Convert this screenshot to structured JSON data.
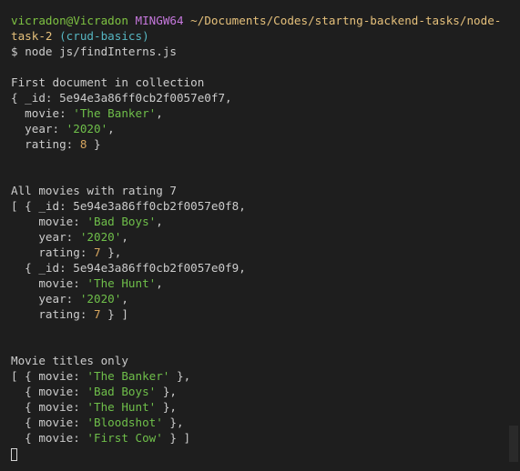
{
  "prompt": {
    "user": "vicradon@Vicradon",
    "system": "MINGW64",
    "path_part1": "~/Documents/Codes/startng-backend-tasks/node-",
    "path_part2": "task-2",
    "branch": "(crud-basics)",
    "symbol": "$",
    "command": "node js/findInterns.js"
  },
  "section1": {
    "heading": "First document in collection",
    "doc": {
      "open": "{ _id: ",
      "id": "5e94e3a86ff0cb2f0057e0f7,",
      "movie_key": "  movie: ",
      "movie": "'The Banker'",
      "year_key": "  year: ",
      "year": "'2020'",
      "rating_key": "  rating: ",
      "rating": "8",
      "close": " }"
    }
  },
  "section2": {
    "heading": "All movies with rating 7",
    "docs": [
      {
        "open": "[ { _id: ",
        "id": "5e94e3a86ff0cb2f0057e0f8,",
        "movie_key": "    movie: ",
        "movie": "'Bad Boys'",
        "year_key": "    year: ",
        "year": "'2020'",
        "rating_key": "    rating: ",
        "rating": "7",
        "close": " },"
      },
      {
        "open": "  { _id: ",
        "id": "5e94e3a86ff0cb2f0057e0f9,",
        "movie_key": "    movie: ",
        "movie": "'The Hunt'",
        "year_key": "    year: ",
        "year": "'2020'",
        "rating_key": "    rating: ",
        "rating": "7",
        "close": " } ]"
      }
    ]
  },
  "section3": {
    "heading": "Movie titles only",
    "rows": [
      {
        "prefix": "[ { movie: ",
        "title": "'The Banker'",
        "suffix": " },"
      },
      {
        "prefix": "  { movie: ",
        "title": "'Bad Boys'",
        "suffix": " },"
      },
      {
        "prefix": "  { movie: ",
        "title": "'The Hunt'",
        "suffix": " },"
      },
      {
        "prefix": "  { movie: ",
        "title": "'Bloodshot'",
        "suffix": " },"
      },
      {
        "prefix": "  { movie: ",
        "title": "'First Cow'",
        "suffix": " } ]"
      }
    ]
  },
  "colors": {
    "background": "#1e1e1e",
    "text": "#cccccc",
    "string": "#6fbf4a",
    "number": "#d7a65f",
    "user": "#7ec242",
    "system": "#c678dd",
    "path": "#e5c07b",
    "branch": "#56b6c2"
  }
}
